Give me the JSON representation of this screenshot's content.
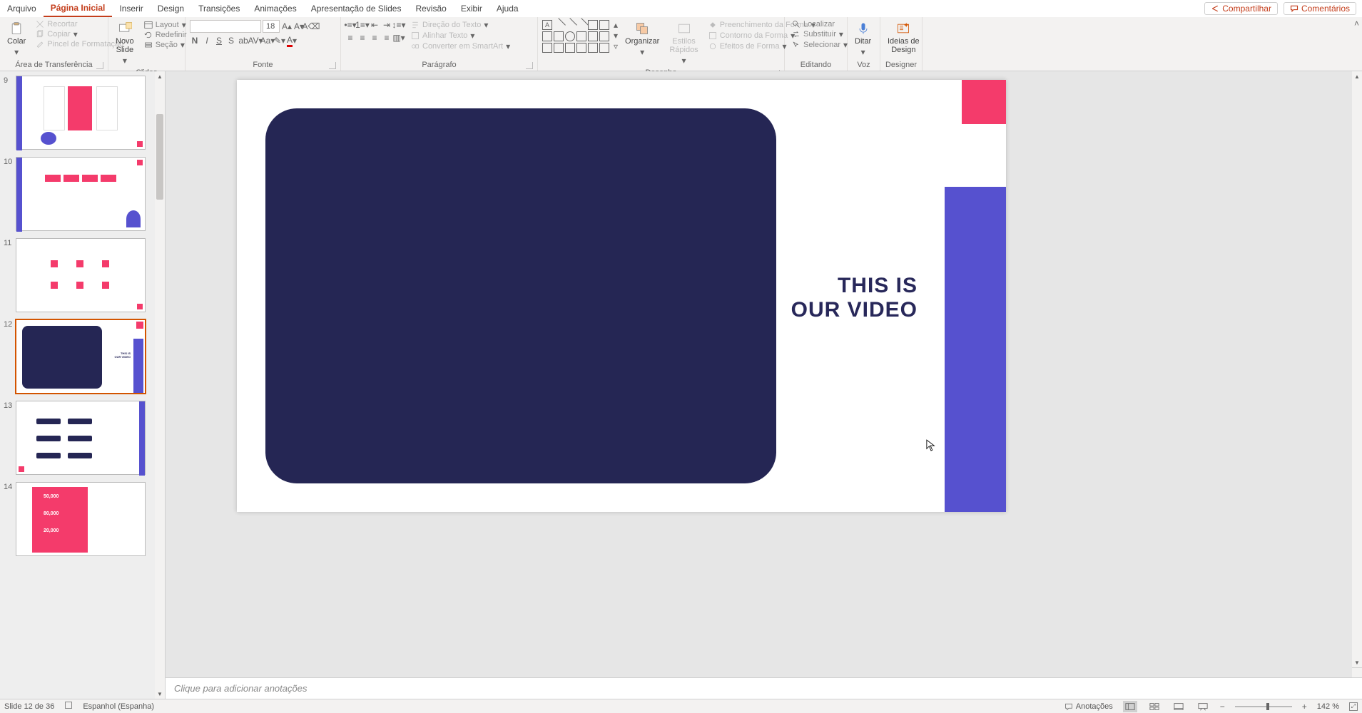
{
  "colors": {
    "accent": "#c43e1c",
    "navy": "#252654",
    "purple": "#5651cf",
    "pink": "#f43b6b"
  },
  "menubar": {
    "tabs": [
      {
        "label": "Arquivo"
      },
      {
        "label": "Página Inicial",
        "active": true
      },
      {
        "label": "Inserir"
      },
      {
        "label": "Design"
      },
      {
        "label": "Transições"
      },
      {
        "label": "Animações"
      },
      {
        "label": "Apresentação de Slides"
      },
      {
        "label": "Revisão"
      },
      {
        "label": "Exibir"
      },
      {
        "label": "Ajuda"
      }
    ],
    "share": "Compartilhar",
    "comments": "Comentários"
  },
  "ribbon": {
    "clipboard": {
      "label": "Área de Transferência",
      "paste": "Colar",
      "cut": "Recortar",
      "copy": "Copiar",
      "format_painter": "Pincel de Formatação"
    },
    "slides": {
      "label": "Slides",
      "new_slide": "Novo\nSlide",
      "layout": "Layout",
      "reset": "Redefinir",
      "section": "Seção"
    },
    "font": {
      "label": "Fonte",
      "size": "18"
    },
    "paragraph": {
      "label": "Parágrafo",
      "text_direction": "Direção do Texto",
      "align_text": "Alinhar Texto",
      "convert_smartart": "Converter em SmartArt"
    },
    "drawing": {
      "label": "Desenho",
      "arrange": "Organizar",
      "quick_styles": "Estilos\nRápidos",
      "shape_fill": "Preenchimento da Forma",
      "shape_outline": "Contorno da Forma",
      "shape_effects": "Efeitos de Forma"
    },
    "editing": {
      "label": "Editando",
      "find": "Localizar",
      "replace": "Substituir",
      "select": "Selecionar"
    },
    "voice": {
      "label": "Voz",
      "dictate": "Ditar"
    },
    "designer": {
      "label": "Designer",
      "ideas": "Ideias de\nDesign"
    }
  },
  "thumbnails": {
    "visible": [
      {
        "n": 9
      },
      {
        "n": 10
      },
      {
        "n": 11
      },
      {
        "n": 12,
        "active": true
      },
      {
        "n": 13
      },
      {
        "n": 14
      }
    ],
    "slide14_numbers": [
      "50,000",
      "80,000",
      "20,000"
    ]
  },
  "slide": {
    "title_l1": "THIS IS",
    "title_l2": "OUR VIDEO"
  },
  "notes_placeholder": "Clique para adicionar anotações",
  "statusbar": {
    "slide_of": "Slide 12 de 36",
    "language": "Espanhol (Espanha)",
    "notes": "Anotações",
    "zoom": "142 %"
  }
}
